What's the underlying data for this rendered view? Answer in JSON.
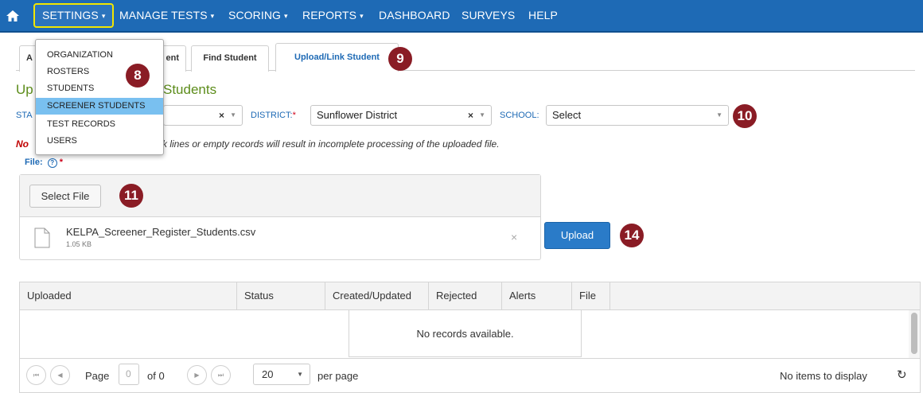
{
  "nav": {
    "items": [
      {
        "label": "SETTINGS",
        "caret": "▾"
      },
      {
        "label": "MANAGE TESTS",
        "caret": "▾"
      },
      {
        "label": "SCORING",
        "caret": "▾"
      },
      {
        "label": "REPORTS",
        "caret": "▾"
      },
      {
        "label": "DASHBOARD"
      },
      {
        "label": "SURVEYS"
      },
      {
        "label": "HELP"
      }
    ],
    "home_icon": "home-icon",
    "highlight_color": "#f2e600",
    "bg_color": "#1e6ab5"
  },
  "tabs": [
    {
      "label": "A"
    },
    {
      "label": "ent"
    },
    {
      "label": "Find Student"
    },
    {
      "label": "Upload/Link Student",
      "active": true
    }
  ],
  "settings_menu": {
    "items": [
      {
        "label": "ORGANIZATION"
      },
      {
        "label": "ROSTERS"
      },
      {
        "label": "STUDENTS"
      },
      {
        "label": "SCREENER STUDENTS",
        "selected": true
      },
      {
        "label": "TEST RECORDS"
      },
      {
        "label": "USERS"
      }
    ]
  },
  "badges": {
    "b8": "8",
    "b9": "9",
    "b10": "10",
    "b11": "11",
    "b14": "14"
  },
  "heading": {
    "visible_left": "Up",
    "visible_right": "Students"
  },
  "filters": {
    "state_label": "STA",
    "district_label": "DISTRICT:",
    "district_value": "Sunflower District",
    "school_label": "SCHOOL:",
    "school_value": "Select",
    "required_mark": "*",
    "clear_glyph": "×",
    "arrow_glyph": "▼"
  },
  "note": {
    "prefix": "No",
    "text": "k lines or empty records will result in incomplete processing of the uploaded file."
  },
  "file_section": {
    "label": "File:",
    "help_icon": "?",
    "required_mark": "*",
    "select_button": "Select File",
    "file_name": "KELPA_Screener_Register_Students.csv",
    "file_size": "1.05 KB",
    "remove_glyph": "×",
    "upload_button": "Upload"
  },
  "grid": {
    "columns": [
      "Uploaded",
      "Status",
      "Created/Updated",
      "Rejected",
      "Alerts",
      "File"
    ],
    "empty_message": "No records available."
  },
  "pager": {
    "first_glyph": "⏮",
    "prev_glyph": "◀",
    "next_glyph": "▶",
    "last_glyph": "⏭",
    "page_label": "Page",
    "page_value": "0",
    "of_label": "of 0",
    "page_size": "20",
    "per_page_label": "per page",
    "status_text": "No items to display",
    "refresh_glyph": "↻"
  },
  "colors": {
    "badge": "#8a1c25",
    "heading": "#5c8c1a",
    "link_blue": "#1e6ab5",
    "selected_menu": "#79c0f0"
  }
}
